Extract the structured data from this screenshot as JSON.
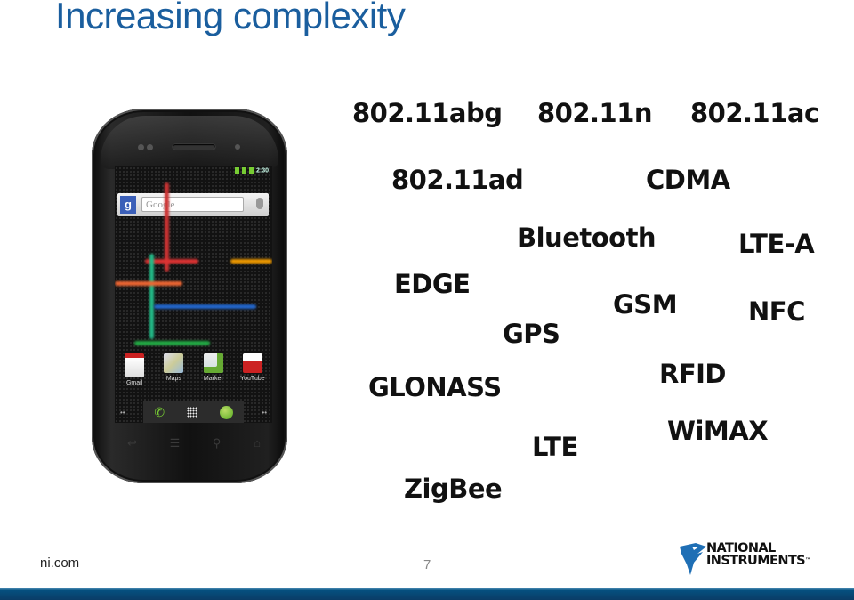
{
  "slide": {
    "title": "Increasing complexity",
    "footer_url": "ni.com",
    "page_number": "7",
    "logo": {
      "line1": "NATIONAL",
      "line2": "INSTRUMENTS",
      "tm": "™"
    },
    "colors": {
      "title": "#1a5e9e",
      "bar_top": "#05507f",
      "bar_bottom": "#0a3c66",
      "logo_blue": "#1f6fb5"
    }
  },
  "terms": [
    "802.11abg",
    "802.11n",
    "802.11ac",
    "802.11ad",
    "CDMA",
    "Bluetooth",
    "LTE-A",
    "EDGE",
    "GSM",
    "NFC",
    "GPS",
    "RFID",
    "GLONASS",
    "WiMAX",
    "LTE",
    "ZigBee"
  ],
  "phone": {
    "status_time": "2:30",
    "search_placeholder": "Google",
    "g_label": "g",
    "apps": [
      {
        "label": "Gmail"
      },
      {
        "label": "Maps"
      },
      {
        "label": "Market"
      },
      {
        "label": "YouTube"
      }
    ]
  }
}
